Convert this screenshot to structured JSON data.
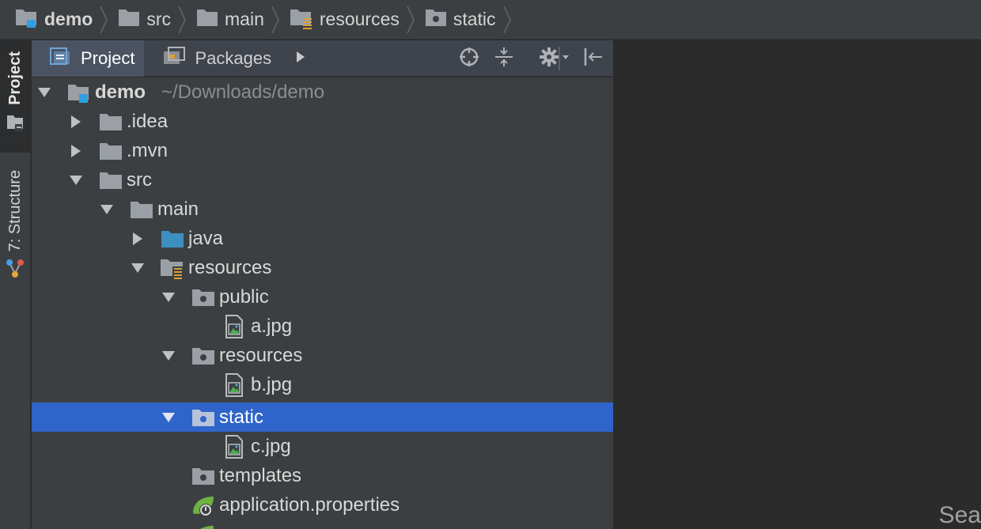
{
  "breadcrumb": [
    {
      "label": "demo",
      "icon": "module-folder-icon"
    },
    {
      "label": "src",
      "icon": "folder-icon"
    },
    {
      "label": "main",
      "icon": "folder-icon"
    },
    {
      "label": "resources",
      "icon": "resources-folder-icon"
    },
    {
      "label": "static",
      "icon": "web-folder-icon"
    }
  ],
  "tool_strip": {
    "project_label": "Project",
    "structure_label": "7: Structure"
  },
  "panel": {
    "tabs": [
      {
        "label": "Project",
        "icon": "project-view-icon",
        "active": true
      },
      {
        "label": "Packages",
        "icon": "packages-view-icon",
        "active": false
      }
    ],
    "actions": [
      "more-tabs-icon",
      "locate-icon",
      "collapse-all-icon",
      "settings-icon",
      "hide-panel-icon"
    ]
  },
  "tree": [
    {
      "name": "demo",
      "path": "~/Downloads/demo",
      "expanded": true,
      "icon": "module-folder-icon"
    },
    {
      "name": ".idea",
      "expanded": false,
      "icon": "folder-icon"
    },
    {
      "name": ".mvn",
      "expanded": false,
      "icon": "folder-icon"
    },
    {
      "name": "src",
      "expanded": true,
      "icon": "folder-icon"
    },
    {
      "name": "main",
      "expanded": true,
      "icon": "folder-icon"
    },
    {
      "name": "java",
      "expanded": false,
      "icon": "source-folder-icon"
    },
    {
      "name": "resources",
      "expanded": true,
      "icon": "resources-folder-icon"
    },
    {
      "name": "public",
      "expanded": true,
      "icon": "web-folder-icon"
    },
    {
      "name": "a.jpg",
      "icon": "image-file-icon"
    },
    {
      "name": "resources",
      "expanded": true,
      "icon": "web-folder-icon"
    },
    {
      "name": "b.jpg",
      "icon": "image-file-icon"
    },
    {
      "name": "static",
      "expanded": true,
      "icon": "web-folder-icon",
      "selected": true
    },
    {
      "name": "c.jpg",
      "icon": "image-file-icon"
    },
    {
      "name": "templates",
      "icon": "web-folder-icon"
    },
    {
      "name": "application.properties",
      "icon": "spring-properties-icon"
    }
  ],
  "editor": {
    "hint_text": "Sea"
  },
  "colors": {
    "selection": "#2f65ca",
    "source_folder": "#3d8fbf",
    "resources_marker": "#d9a13a",
    "spring_green": "#6db33f"
  }
}
